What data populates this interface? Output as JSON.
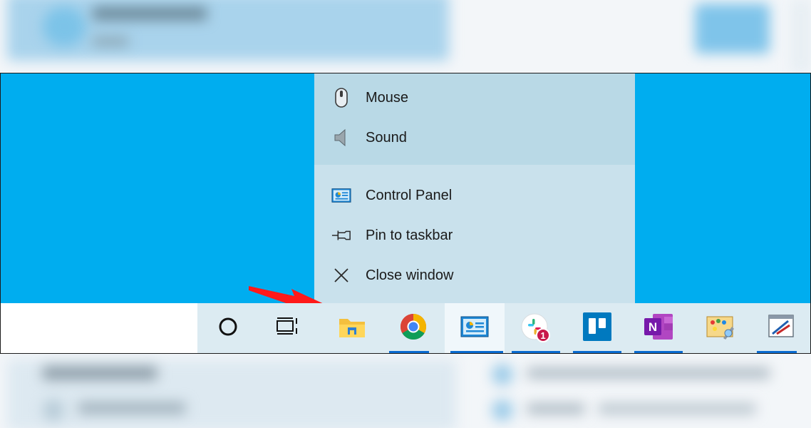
{
  "jump_list": {
    "tasks": [
      {
        "label": "Mouse",
        "icon": "mouse-icon"
      },
      {
        "label": "Sound",
        "icon": "speaker-icon"
      }
    ],
    "actions": [
      {
        "label": "Control Panel",
        "icon": "control-panel-icon"
      },
      {
        "label": "Pin to taskbar",
        "icon": "pin-icon"
      },
      {
        "label": "Close window",
        "icon": "close-icon"
      }
    ]
  },
  "taskbar": {
    "apps": [
      {
        "name": "Cortana",
        "icon": "cortana-circle-icon"
      },
      {
        "name": "Task View",
        "icon": "task-view-icon"
      },
      {
        "name": "File Explorer",
        "icon": "folder-icon"
      },
      {
        "name": "Google Chrome",
        "icon": "chrome-icon"
      },
      {
        "name": "Control Panel",
        "icon": "control-panel-icon"
      },
      {
        "name": "Slack",
        "icon": "slack-icon",
        "badge": "1"
      },
      {
        "name": "Trello",
        "icon": "trello-icon"
      },
      {
        "name": "OneNote",
        "icon": "onenote-icon"
      },
      {
        "name": "Paint",
        "icon": "paint-icon"
      },
      {
        "name": "Snipping Tool",
        "icon": "snipping-tool-icon"
      }
    ]
  },
  "colors": {
    "desktop": "#00adef",
    "jump_list": "#c9e1ec",
    "taskbar": "#dcebf2",
    "accent": "#0a6bd0",
    "annotation_arrow": "#ff1a1a"
  }
}
